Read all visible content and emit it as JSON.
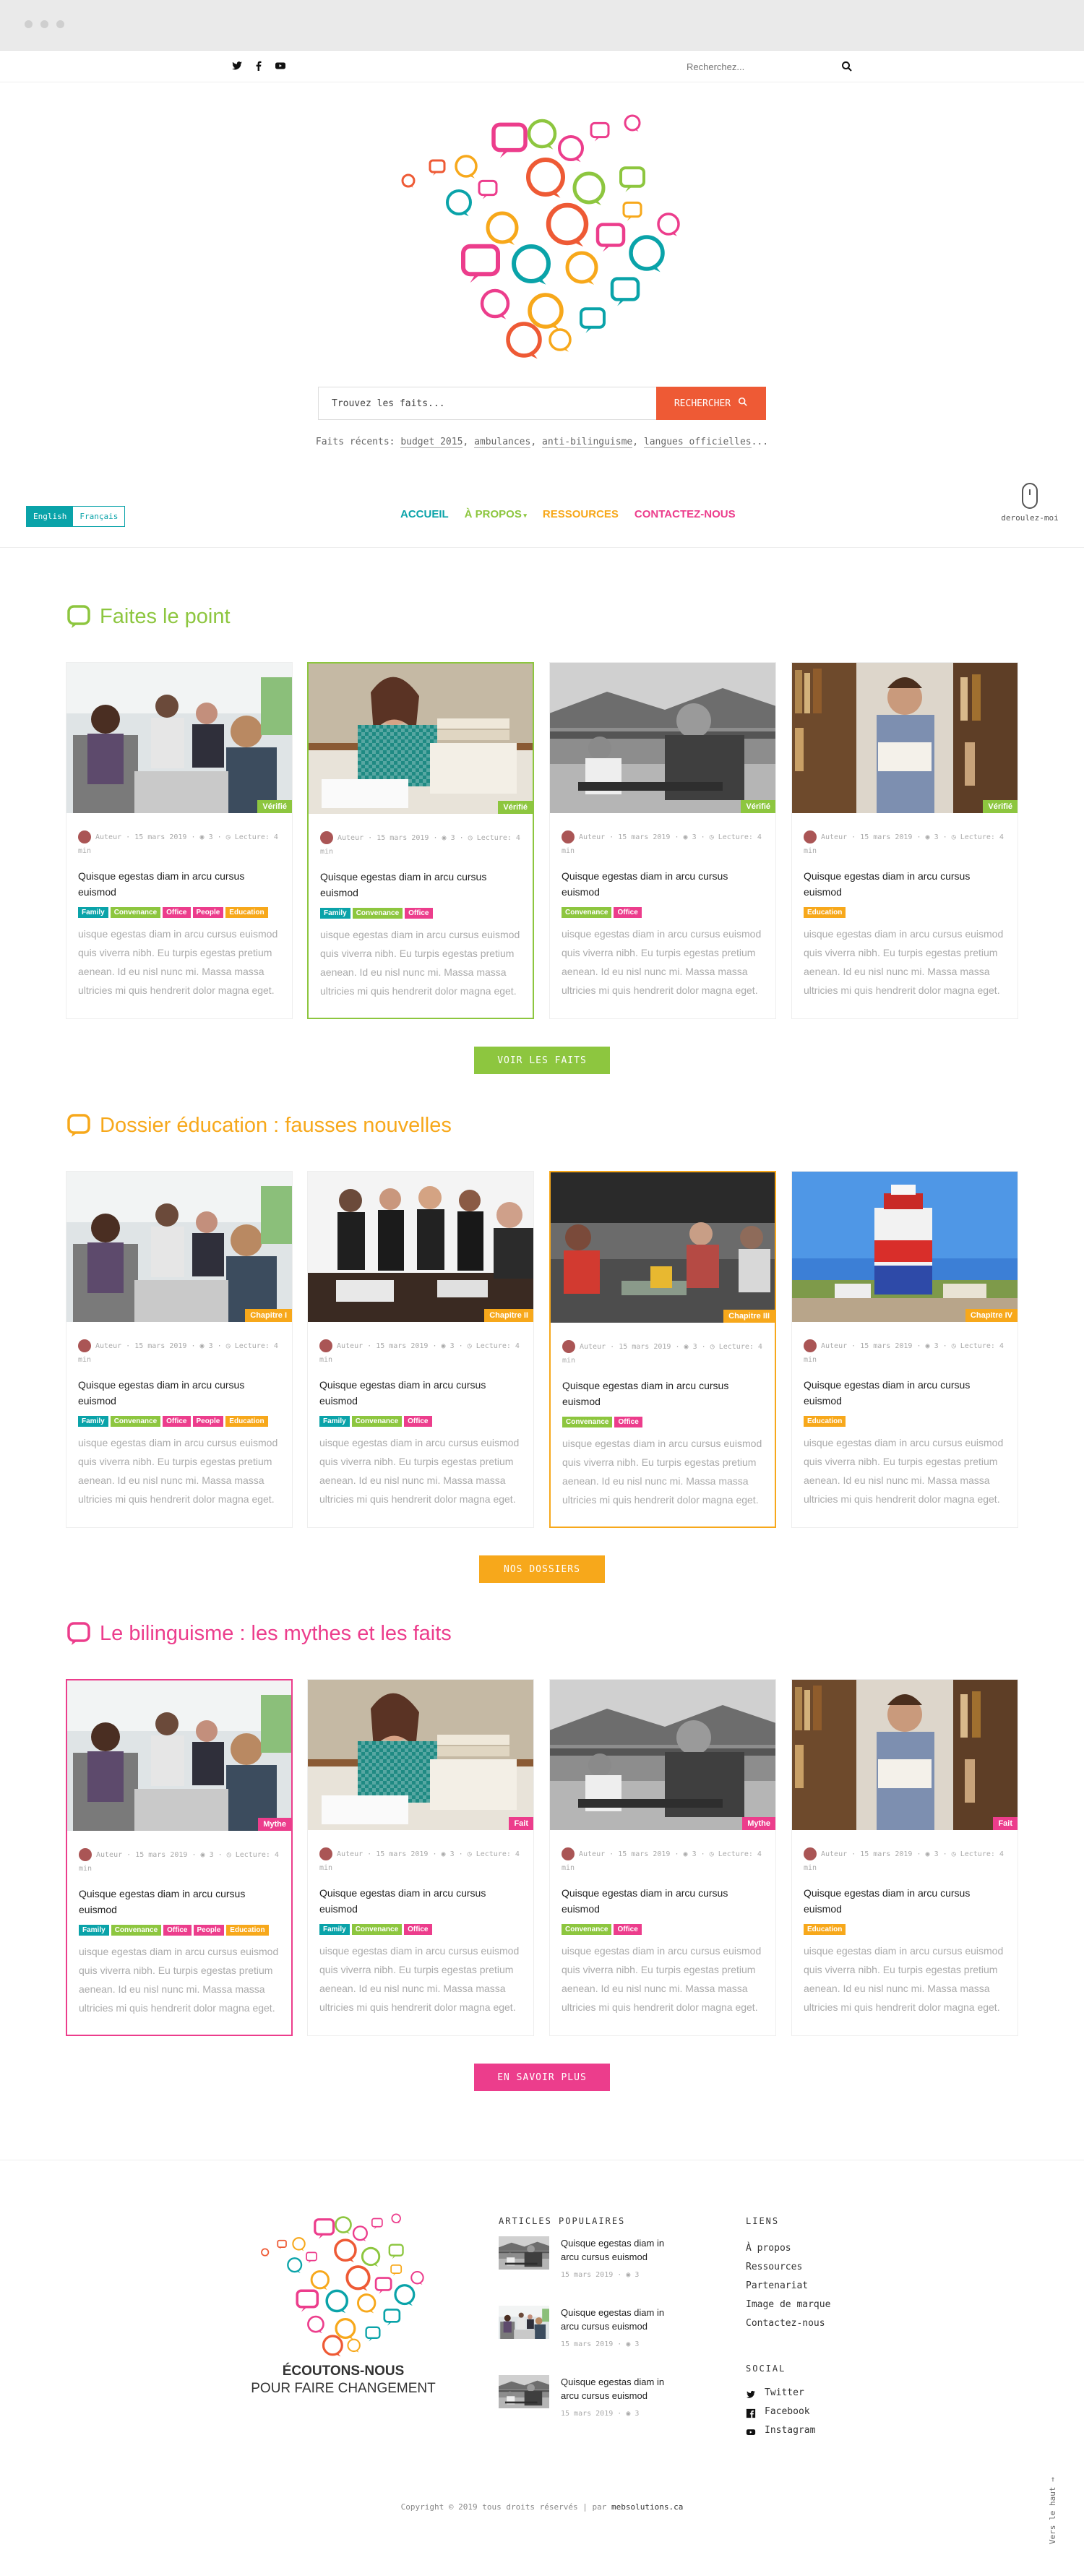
{
  "topbar": {
    "social": [
      "twitter-icon",
      "facebook-icon",
      "youtube-icon"
    ],
    "search_placeholder": "Recherchez..."
  },
  "hero": {
    "search_placeholder": "Trouvez les faits...",
    "search_button": "RECHERCHER",
    "recent_label": "Faits récents:",
    "recent_links": [
      "budget 2015",
      "ambulances",
      "anti-bilinguisme",
      "langues officielles"
    ],
    "recent_suffix": "..."
  },
  "lang": {
    "english": "English",
    "francais": "Français"
  },
  "nav": {
    "items": [
      {
        "label": "ACCUEIL",
        "color": "#0aa3a9"
      },
      {
        "label": "À PROPOS",
        "color": "#8dc63f"
      },
      {
        "label": "RESSOURCES",
        "color": "#f7a81b"
      },
      {
        "label": "CONTACTEZ-NOUS",
        "color": "#ec3d8c"
      }
    ],
    "scroll_label": "deroulez-moi"
  },
  "card_defaults": {
    "author": "Auteur",
    "date": "15 mars 2019",
    "views": "3",
    "reading": "Lecture:",
    "reading_time": "4 min",
    "title": "Quisque egestas diam in arcu cursus euismod",
    "excerpt": "uisque egestas diam in arcu cursus euismod quis viverra nibh. Eu turpis egestas pretium aenean. Id eu nisl nunc mi. Massa massa ultricies mi quis hendrerit dolor magna eget."
  },
  "sections": [
    {
      "title": "Faites le point",
      "color": "#8dc63f",
      "button": "VOIR LES FAITS",
      "badges": [
        "Vérifié",
        "Vérifié",
        "Vérifié",
        "Vérifié"
      ]
    },
    {
      "title": "Dossier éducation : fausses nouvelles",
      "color": "#f7a81b",
      "button": "NOS DOSSIERS",
      "badges": [
        "Chapitre I",
        "Chapitre II",
        "Chapitre III",
        "Chapitre IV"
      ]
    },
    {
      "title": "Le bilinguisme : les mythes et les faits",
      "color": "#ec3d8c",
      "button": "EN SAVOIR PLUS",
      "badges": [
        "Mythe",
        "Fait",
        "Mythe",
        "Fait"
      ]
    }
  ],
  "tag_sets": [
    [
      {
        "t": "Family",
        "c": "#0aa3a9"
      },
      {
        "t": "Convenance",
        "c": "#8dc63f"
      },
      {
        "t": "Office",
        "c": "#ec3d8c"
      },
      {
        "t": "People",
        "c": "#ec3d8c"
      },
      {
        "t": "Education",
        "c": "#f7a81b"
      }
    ],
    [
      {
        "t": "Family",
        "c": "#0aa3a9"
      },
      {
        "t": "Convenance",
        "c": "#8dc63f"
      },
      {
        "t": "Office",
        "c": "#ec3d8c"
      }
    ],
    [
      {
        "t": "Convenance",
        "c": "#8dc63f"
      },
      {
        "t": "Office",
        "c": "#ec3d8c"
      }
    ],
    [
      {
        "t": "Education",
        "c": "#f7a81b"
      }
    ]
  ],
  "footer": {
    "brand_line1": "ÉCOUTONS-NOUS",
    "brand_line2": "POUR FAIRE CHANGEMENT",
    "popular_heading": "ARTICLES POPULAIRES",
    "popular": [
      {
        "title": "Quisque egestas diam in arcu cursus euismod",
        "date": "15 mars 2019",
        "views": "3"
      },
      {
        "title": "Quisque egestas diam in arcu cursus euismod",
        "date": "15 mars 2019",
        "views": "3"
      },
      {
        "title": "Quisque egestas diam in arcu cursus euismod",
        "date": "15 mars 2019",
        "views": "3"
      }
    ],
    "links_heading": "LIENS",
    "links": [
      "À propos",
      "Ressources",
      "Partenariat",
      "Image de marque",
      "Contactez-nous"
    ],
    "social_heading": "SOCIAL",
    "social": [
      {
        "label": "Twitter",
        "icon": "twitter-icon"
      },
      {
        "label": "Facebook",
        "icon": "facebook-icon"
      },
      {
        "label": "Instagram",
        "icon": "instagram-icon"
      }
    ],
    "copyright": "Copyright © 2019 tous droits réservés | par",
    "credit": "mebsolutions.ca",
    "back_top": "Vers le haut →"
  }
}
